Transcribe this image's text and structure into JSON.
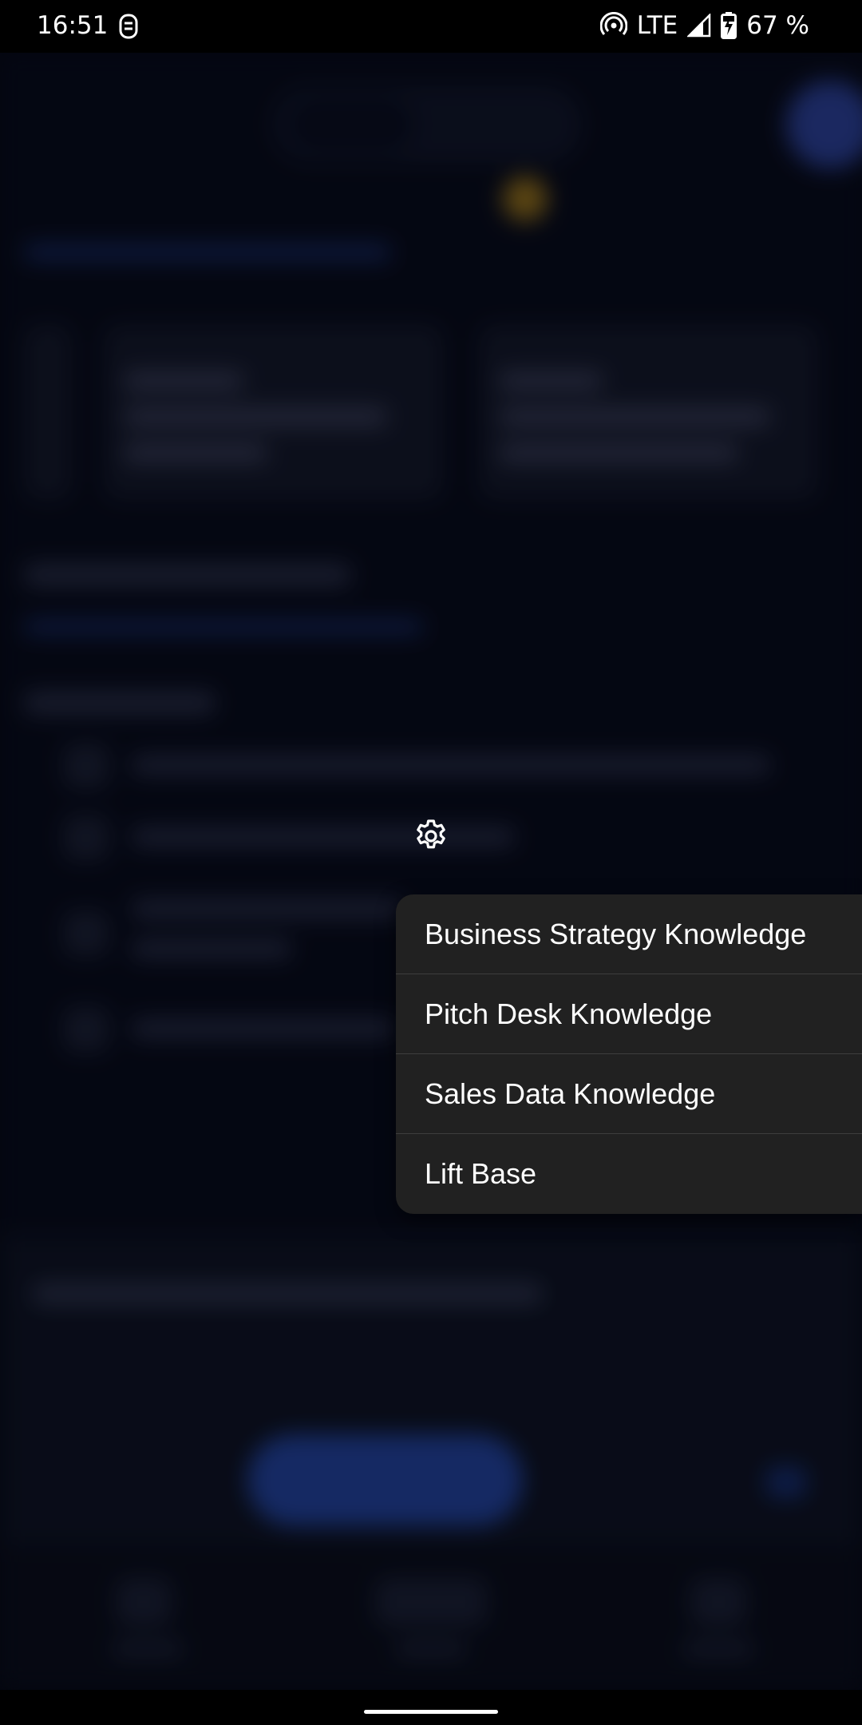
{
  "status_bar": {
    "time": "16:51",
    "network": "LTE",
    "battery": "67 %",
    "icons": [
      "hotspot-icon",
      "signal-icon",
      "battery-charging-icon",
      "app-notification-icon"
    ]
  },
  "gear": {
    "icon": "gear-icon"
  },
  "popup_menu": {
    "items": [
      {
        "label": "Business Strategy Knowledge"
      },
      {
        "label": "Pitch Desk Knowledge"
      },
      {
        "label": "Sales Data Knowledge"
      },
      {
        "label": "Lift Base"
      }
    ]
  },
  "colors": {
    "menu_bg": "#212121",
    "divider": "#3d3d3d",
    "accent": "#2f5ee0",
    "background": "#060915"
  }
}
